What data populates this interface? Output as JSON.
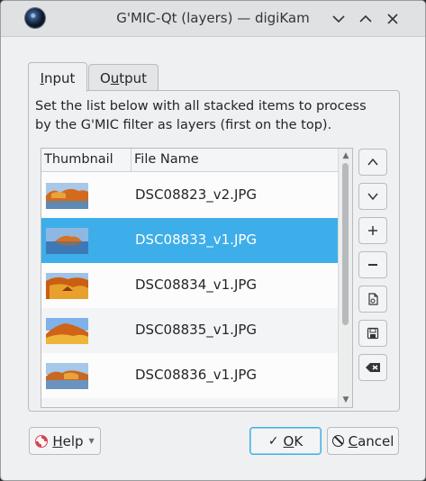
{
  "window": {
    "title": "G'MIC-Qt (layers) — digiKam"
  },
  "tabs": [
    {
      "label_first": "I",
      "label_rest": "nput",
      "active": true
    },
    {
      "label_pre": "O",
      "label_u": "u",
      "label_post": "tput",
      "active": false
    }
  ],
  "description": "Set the list below with all stacked items to process\nby the G'MIC filter as layers (first on the top).",
  "table": {
    "columns": [
      "Thumbnail",
      "File Name"
    ],
    "rows": [
      {
        "file": "DSC08823_v2.JPG",
        "selected": false
      },
      {
        "file": "DSC08833_v1.JPG",
        "selected": true
      },
      {
        "file": "DSC08834_v1.JPG",
        "selected": false
      },
      {
        "file": "DSC08835_v1.JPG",
        "selected": false
      },
      {
        "file": "DSC08836_v1.JPG",
        "selected": false
      }
    ]
  },
  "side_buttons": [
    "move-up",
    "move-down",
    "add",
    "remove",
    "load",
    "save",
    "clear"
  ],
  "footer": {
    "help_label_u": "H",
    "help_label_rest": "elp",
    "ok_label_u": "O",
    "ok_label_rest": "K",
    "cancel_label_u": "C",
    "cancel_label_rest": "ancel"
  },
  "colors": {
    "selection": "#3daee9",
    "accent": "#3daee9",
    "help_red": "#da4453"
  }
}
